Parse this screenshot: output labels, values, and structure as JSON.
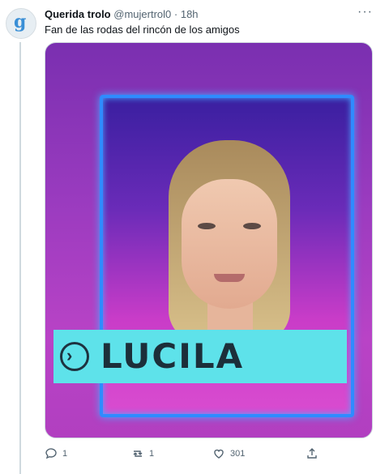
{
  "tweet": {
    "author_name": "Querida trolo",
    "handle": "@mujertrol0",
    "separator": "·",
    "time": "18h",
    "more": "···",
    "text": "Fan de las rodas del rincón de los amigos"
  },
  "media": {
    "name_label": "LUCILA",
    "arrow": "›",
    "colors": {
      "background": "#9a3bbf",
      "frame": "#2f8bff",
      "name_bar": "#5ee2ea"
    }
  },
  "actions": {
    "reply_count": "1",
    "retweet_count": "1",
    "like_count": "301"
  },
  "avatar_glyph": "g"
}
